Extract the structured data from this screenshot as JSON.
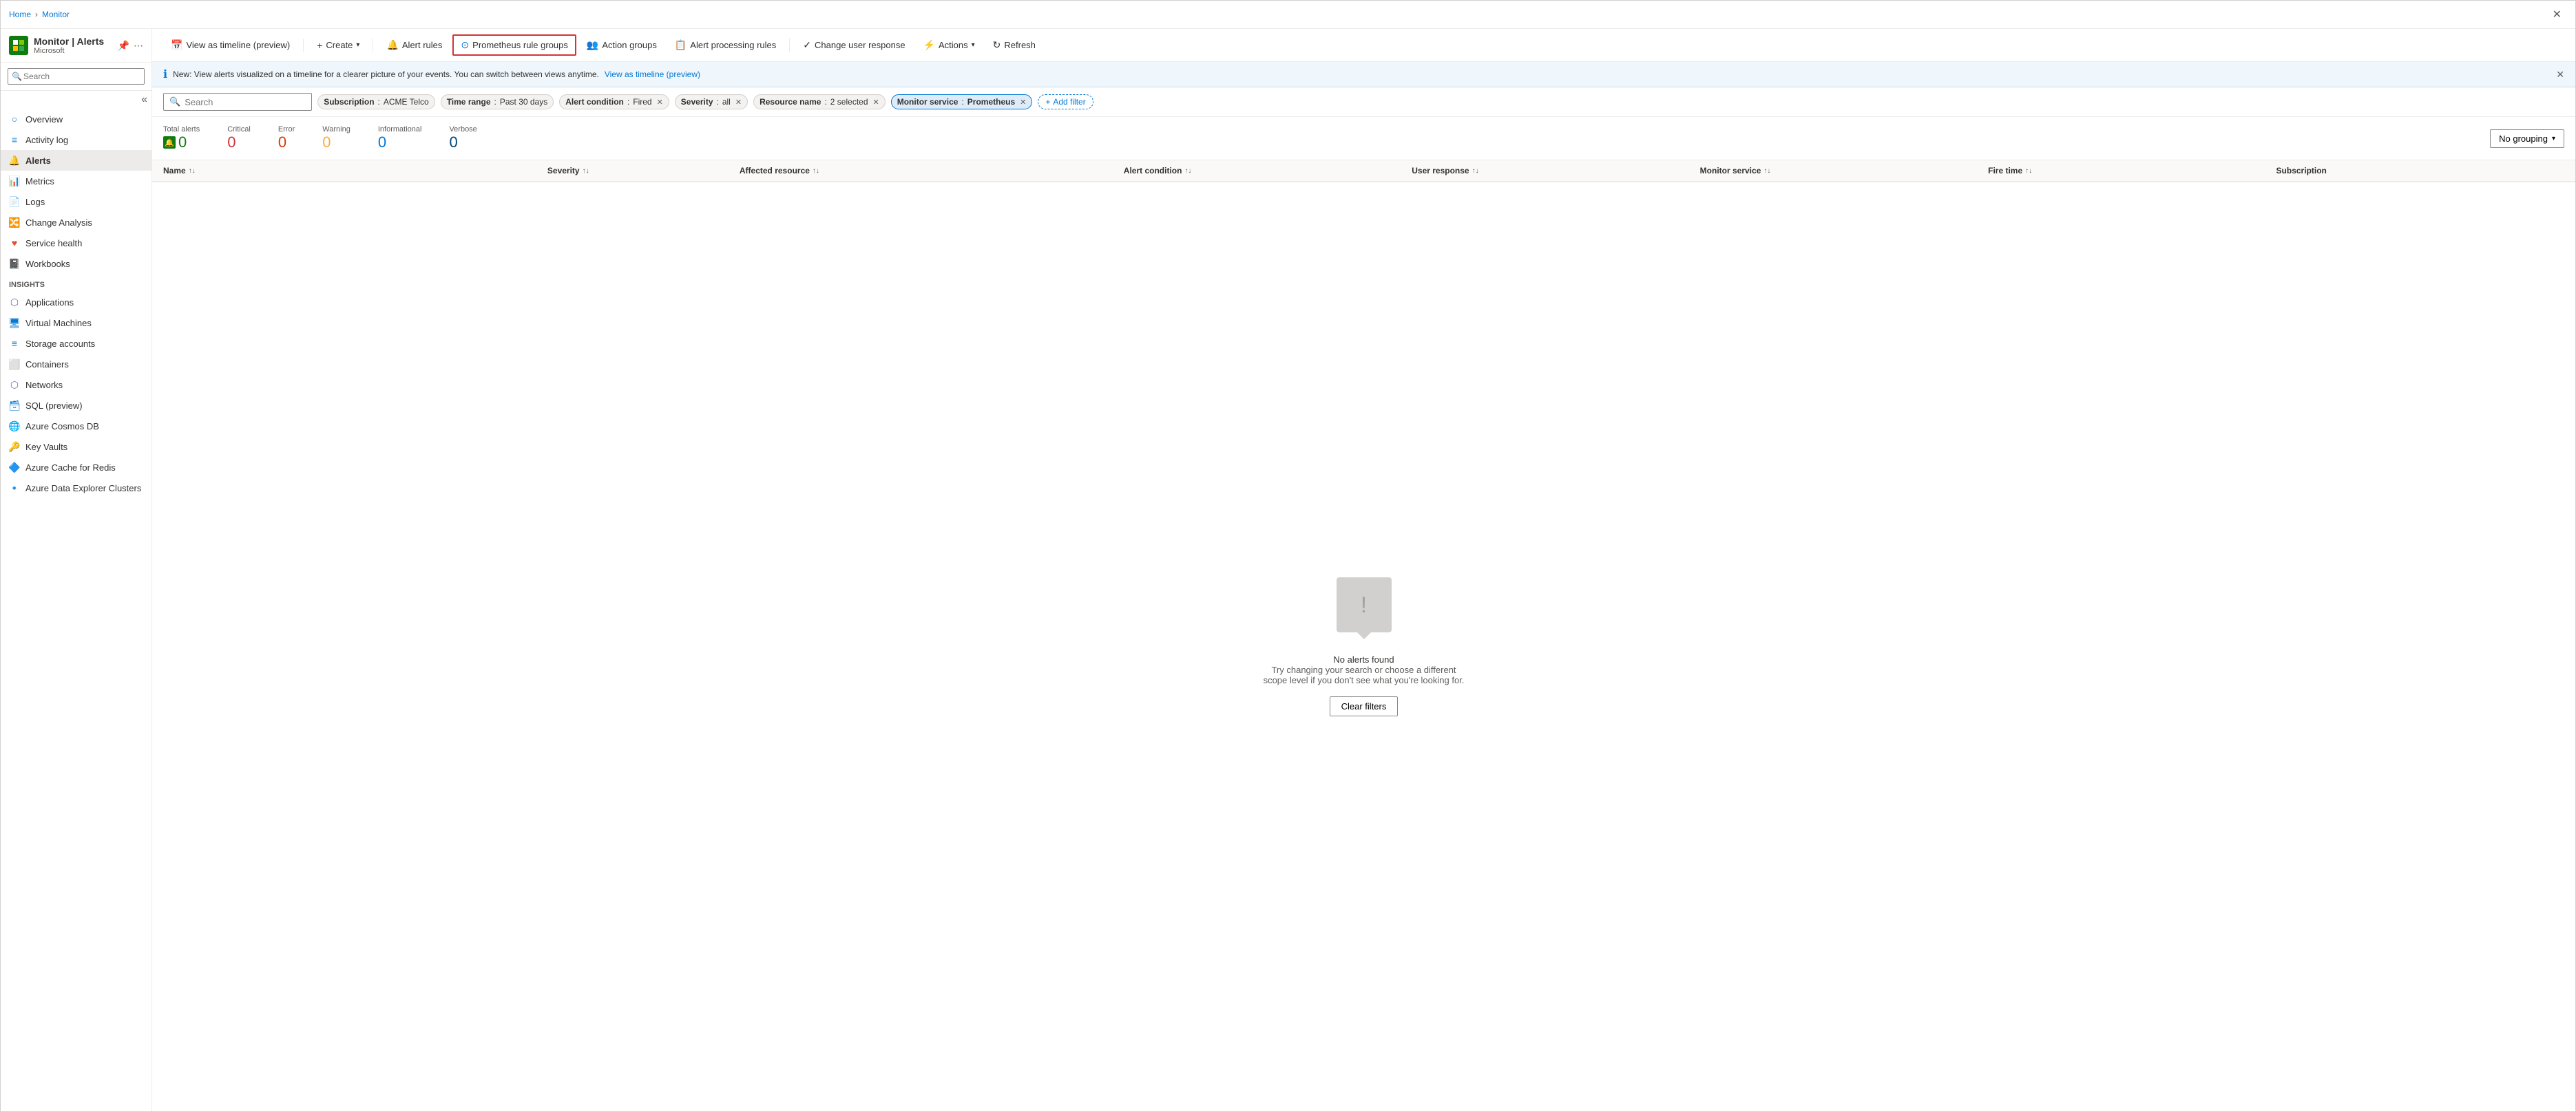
{
  "breadcrumb": {
    "home": "Home",
    "monitor": "Monitor"
  },
  "header": {
    "title": "Monitor | Alerts",
    "subtitle": "Microsoft",
    "pin_label": "Pin",
    "more_label": "More"
  },
  "toolbar": {
    "view_timeline": "View as timeline (preview)",
    "create": "Create",
    "alert_rules": "Alert rules",
    "prometheus_rule_groups": "Prometheus rule groups",
    "action_groups": "Action groups",
    "alert_processing_rules": "Alert processing rules",
    "change_user_response": "Change user response",
    "actions": "Actions",
    "refresh": "Refresh"
  },
  "banner": {
    "text": "New: View alerts visualized on a timeline for a clearer picture of your events. You can switch between views anytime.",
    "link_text": "View as timeline (preview)"
  },
  "filters": {
    "search_placeholder": "Search",
    "subscription_label": "Subscription",
    "subscription_value": "ACME Telco",
    "time_range_label": "Time range",
    "time_range_value": "Past 30 days",
    "alert_condition_label": "Alert condition",
    "alert_condition_value": "Fired",
    "severity_label": "Severity",
    "severity_value": "all",
    "resource_name_label": "Resource name",
    "resource_name_value": "2 selected",
    "monitor_service_label": "Monitor service",
    "monitor_service_value": "Prometheus",
    "add_filter_label": "Add filter"
  },
  "summary": {
    "total_alerts_label": "Total alerts",
    "total_alerts_value": "0",
    "critical_label": "Critical",
    "critical_value": "0",
    "error_label": "Error",
    "error_value": "0",
    "warning_label": "Warning",
    "warning_value": "0",
    "informational_label": "Informational",
    "informational_value": "0",
    "verbose_label": "Verbose",
    "verbose_value": "0",
    "grouping_label": "No grouping"
  },
  "table": {
    "columns": [
      {
        "label": "Name",
        "key": "name"
      },
      {
        "label": "Severity",
        "key": "severity"
      },
      {
        "label": "Affected resource",
        "key": "affected_resource"
      },
      {
        "label": "Alert condition",
        "key": "alert_condition"
      },
      {
        "label": "User response",
        "key": "user_response"
      },
      {
        "label": "Monitor service",
        "key": "monitor_service"
      },
      {
        "label": "Fire time",
        "key": "fire_time"
      },
      {
        "label": "Subscription",
        "key": "subscription"
      }
    ]
  },
  "empty_state": {
    "title": "No alerts found",
    "description": "Try changing your search or choose a different scope level if you don't see what you're looking for.",
    "clear_filters_label": "Clear filters"
  },
  "sidebar": {
    "search_placeholder": "Search",
    "nav_items": [
      {
        "label": "Overview",
        "icon": "circle",
        "active": false
      },
      {
        "label": "Activity log",
        "icon": "list",
        "active": false
      },
      {
        "label": "Alerts",
        "icon": "bell",
        "active": true
      },
      {
        "label": "Metrics",
        "icon": "chart",
        "active": false
      },
      {
        "label": "Logs",
        "icon": "doc",
        "active": false
      },
      {
        "label": "Change Analysis",
        "icon": "change",
        "active": false
      },
      {
        "label": "Service health",
        "icon": "heart",
        "active": false
      },
      {
        "label": "Workbooks",
        "icon": "book",
        "active": false
      }
    ],
    "insights_label": "Insights",
    "insights_items": [
      {
        "label": "Applications",
        "icon": "app"
      },
      {
        "label": "Virtual Machines",
        "icon": "vm"
      },
      {
        "label": "Storage accounts",
        "icon": "storage"
      },
      {
        "label": "Containers",
        "icon": "container"
      },
      {
        "label": "Networks",
        "icon": "network"
      },
      {
        "label": "SQL (preview)",
        "icon": "sql"
      },
      {
        "label": "Azure Cosmos DB",
        "icon": "cosmos"
      },
      {
        "label": "Key Vaults",
        "icon": "key"
      },
      {
        "label": "Azure Cache for Redis",
        "icon": "redis"
      },
      {
        "label": "Azure Data Explorer Clusters",
        "icon": "explorer"
      }
    ]
  }
}
